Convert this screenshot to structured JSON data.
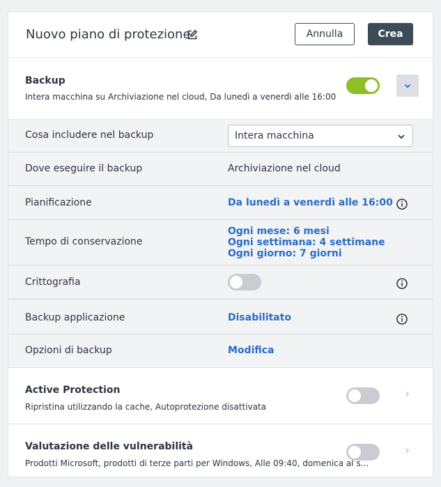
{
  "header": {
    "title": "Nuovo piano di protezione",
    "cancel_label": "Annulla",
    "create_label": "Crea"
  },
  "backup": {
    "title": "Backup",
    "subtitle": "Intera macchina su Archiviazione nel cloud, Da lunedì a venerdì alle 16:00",
    "enabled": true
  },
  "rows": {
    "what": {
      "label": "Cosa includere nel backup",
      "value": "Intera macchina"
    },
    "where": {
      "label": "Dove eseguire il backup",
      "value": "Archiviazione nel cloud"
    },
    "schedule": {
      "label": "Pianificazione",
      "value": "Da lunedì a venerdì alle 16:00"
    },
    "retention": {
      "label": "Tempo di conservazione",
      "monthly": "Ogni mese: 6 mesi",
      "weekly": "Ogni settimana: 4 settimane",
      "daily": "Ogni giorno: 7 giorni"
    },
    "encryption": {
      "label": "Crittografia",
      "enabled": false
    },
    "app_backup": {
      "label": "Backup applicazione",
      "value": "Disabilitato"
    },
    "options": {
      "label": "Opzioni di backup",
      "value": "Modifica"
    }
  },
  "active_protection": {
    "title": "Active Protection",
    "subtitle": "Ripristina utilizzando la cache, Autoprotezione disattivata",
    "enabled": false
  },
  "vulnerability": {
    "title": "Valutazione delle vulnerabilità",
    "subtitle": "Prodotti Microsoft, prodotti di terze parti per Windows, Alle 09:40, domenica al s...",
    "enabled": false
  },
  "colors": {
    "accent": "#2b6cc4",
    "toggle_on": "#8cbf28",
    "dark_button": "#3d4a58"
  },
  "icons": {
    "edit": "pencil-square-icon",
    "info": "info-icon",
    "collapse": "chevron-down-icon",
    "expand": "chevron-right-icon"
  }
}
